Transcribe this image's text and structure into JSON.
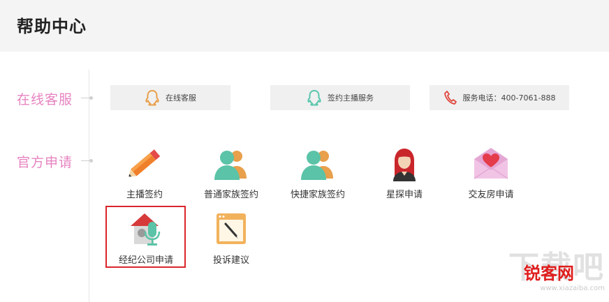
{
  "header": {
    "title": "帮助中心"
  },
  "sections": {
    "online": {
      "label": "在线客服"
    },
    "official": {
      "label": "官方申请"
    }
  },
  "services": [
    {
      "label": "在线客服",
      "icon": "qq-icon",
      "color": "#e8a04b"
    },
    {
      "label": "签约主播服务",
      "icon": "qq-icon",
      "color": "#58c6ad"
    },
    {
      "label": "服务电话：400-7061-888",
      "icon": "phone-icon",
      "color": "#e0443b"
    }
  ],
  "apps": [
    {
      "label": "主播签约",
      "icon": "pencil-icon"
    },
    {
      "label": "普通家族签约",
      "icon": "group-icon"
    },
    {
      "label": "快捷家族签约",
      "icon": "group-icon"
    },
    {
      "label": "星探申请",
      "icon": "woman-avatar-icon"
    },
    {
      "label": "交友房申请",
      "icon": "love-letter-icon"
    },
    {
      "label": "经纪公司申请",
      "icon": "house-microphone-icon"
    },
    {
      "label": "投诉建议",
      "icon": "window-brush-icon"
    }
  ],
  "watermark": {
    "big": "下载吧",
    "red": "锐客网",
    "url": "www.xiazaiba.com"
  },
  "colors": {
    "section_label": "#e784c1",
    "highlight": "#d9262c",
    "header_bg": "#f4f4f4"
  }
}
